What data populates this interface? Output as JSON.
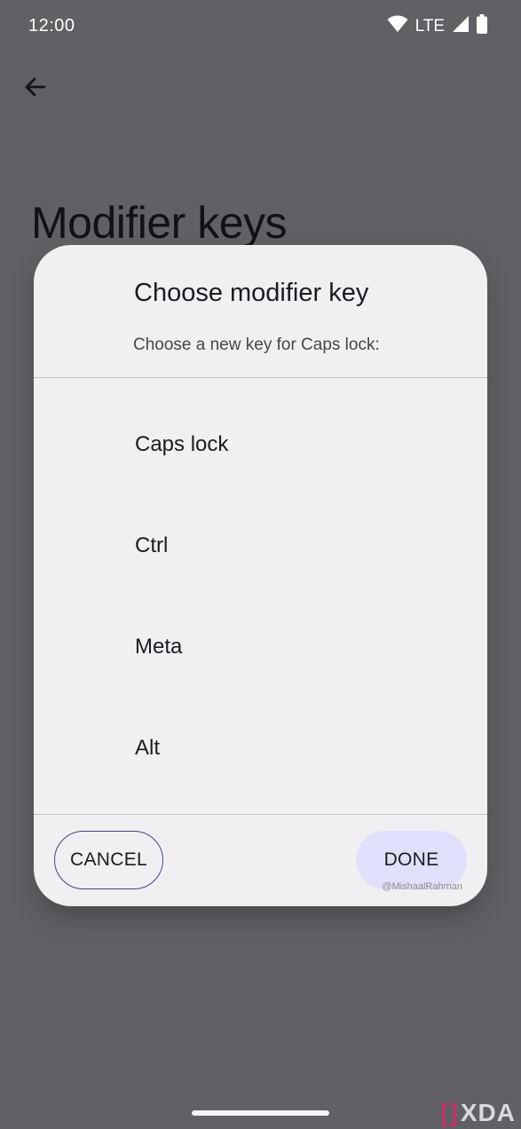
{
  "status_bar": {
    "time": "12:00",
    "network": "LTE",
    "icons": [
      "wifi-icon",
      "signal-icon",
      "battery-icon"
    ]
  },
  "background": {
    "page_title": "Modifier keys",
    "back_icon": "arrow-back-icon"
  },
  "dialog": {
    "title": "Choose modifier key",
    "subtitle": "Choose a new key for Caps lock:",
    "options": [
      {
        "label": "Caps lock"
      },
      {
        "label": "Ctrl"
      },
      {
        "label": "Meta"
      },
      {
        "label": "Alt"
      }
    ],
    "cancel_label": "CANCEL",
    "done_label": "DONE",
    "watermark": "@MishaalRahman"
  },
  "footer": {
    "logo_text": "XDA"
  },
  "colors": {
    "scrim_background": "#616064",
    "dialog_surface": "#f2eff3",
    "done_button": "#e0e0fb",
    "cancel_outline": "#3f4680"
  }
}
